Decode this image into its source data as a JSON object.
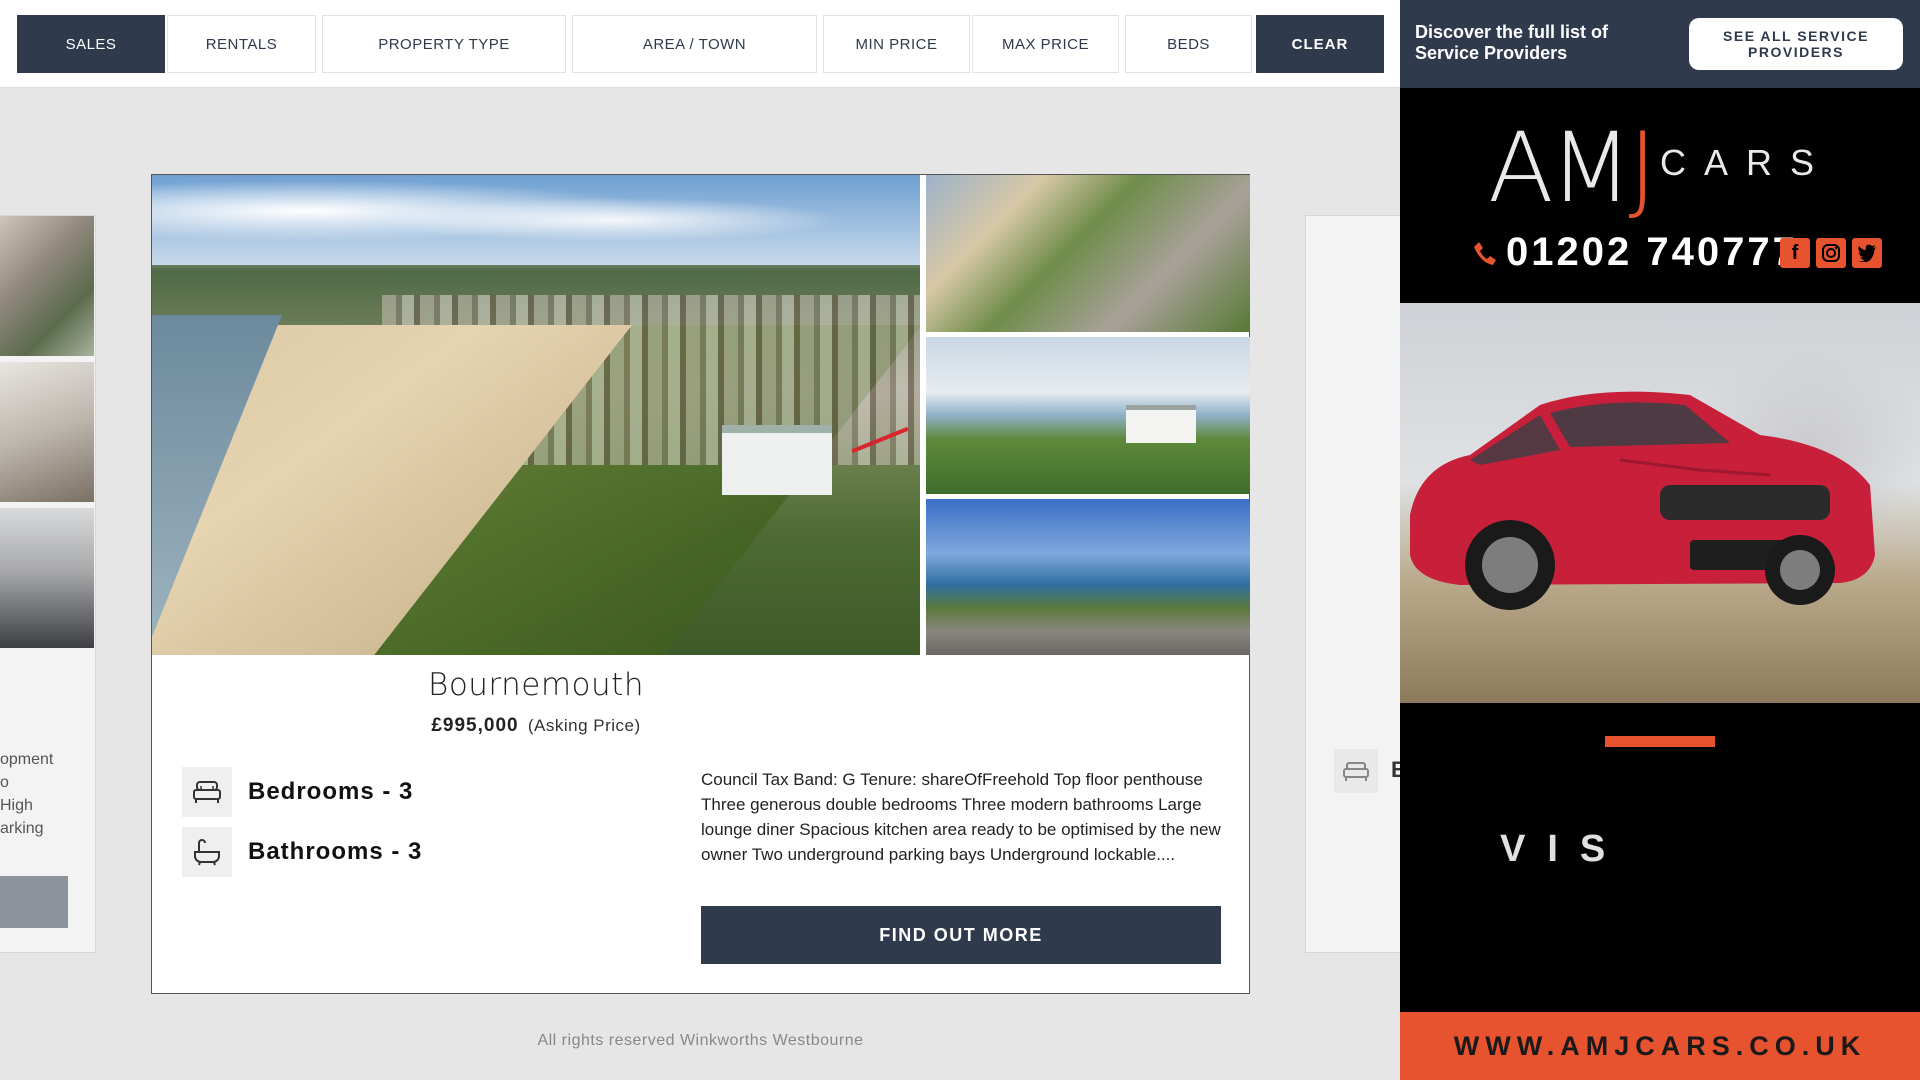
{
  "filters": {
    "sales": "SALES",
    "rentals": "RENTALS",
    "property_type": "PROPERTY TYPE",
    "area_town": "AREA / TOWN",
    "min_price": "MIN PRICE",
    "max_price": "MAX PRICE",
    "beds": "BEDS",
    "clear": "CLEAR"
  },
  "left_peek": {
    "lines": [
      "opment",
      "o",
      "High",
      "arking"
    ]
  },
  "right_peek": {
    "label": "B"
  },
  "listing": {
    "title": "Bournemouth",
    "price": "£995,000",
    "price_qualifier": "(Asking Price)",
    "bedrooms": "Bedrooms - 3",
    "bathrooms": "Bathrooms - 3",
    "description": "Council Tax Band: G Tenure: shareOfFreehold Top floor penthouse Three generous double bedrooms Three modern bathrooms Large lounge diner Spacious kitchen area ready to be optimised by the new owner Two underground parking bays Underground lockable....",
    "cta": "FIND OUT MORE"
  },
  "footer": "All rights reserved Winkworths Westbourne",
  "sidebar": {
    "discover_text": "Discover the full list of Service Providers",
    "see_all": "SEE ALL SERVICE PROVIDERS"
  },
  "ad": {
    "logo": "AM",
    "logo_j": "J",
    "brand_suffix": "CARS",
    "phone": "01202 740777",
    "vis_text": "VIS",
    "url": "WWW.AMJCARS.CO.UK",
    "accent_color": "#e6532e"
  },
  "colors": {
    "navy": "#2f3b4d",
    "background": "#e6e6e6"
  }
}
